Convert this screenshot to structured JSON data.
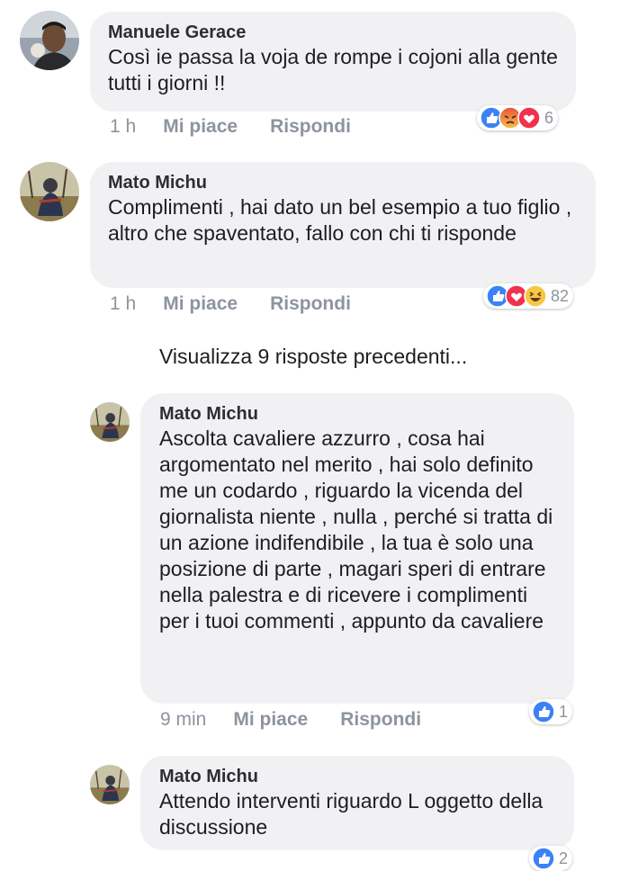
{
  "comments": [
    {
      "author": "Manuele Gerace",
      "text": "Così ie passa la voja de rompe i cojoni alla gente tutti i giorni !!",
      "time": "1 h",
      "like": "Mi piace",
      "reply": "Rispondi",
      "reactions": [
        "like-icon",
        "angry-icon",
        "love-icon"
      ],
      "reaction_count": "6"
    },
    {
      "author": "Mato Michu",
      "text": "Complimenti , hai dato un bel esempio a tuo figlio , altro che spaventato, fallo con chi ti risponde",
      "time": "1 h",
      "like": "Mi piace",
      "reply": "Rispondi",
      "reactions": [
        "like-icon",
        "love-icon",
        "haha-icon"
      ],
      "reaction_count": "82"
    }
  ],
  "view_more": "Visualizza 9 risposte precedenti...",
  "replies": [
    {
      "author": "Mato Michu",
      "text": "Ascolta cavaliere azzurro , cosa hai argomentato nel merito , hai solo definito me un codardo , riguardo la vicenda del giornalista niente , nulla , perché si tratta di un azione indifendibile , la tua è solo una posizione di parte , magari speri di entrare nella palestra e di ricevere i complimenti per i tuoi commenti , appunto da cavaliere",
      "time": "9 min",
      "like": "Mi piace",
      "reply": "Rispondi",
      "reactions": [
        "like-icon"
      ],
      "reaction_count": "1"
    },
    {
      "author": "Mato Michu",
      "text": "Attendo interventi riguardo L oggetto della discussione",
      "reactions": [
        "like-icon"
      ],
      "reaction_count": "2"
    }
  ],
  "colors": {
    "bubble": "#f1f1f3",
    "like_blue": "#3b82f6",
    "love_red": "#f0324e",
    "angry_orange": "#f08a3a",
    "haha_yellow": "#f7c646",
    "meta_gray": "#8d949e"
  }
}
